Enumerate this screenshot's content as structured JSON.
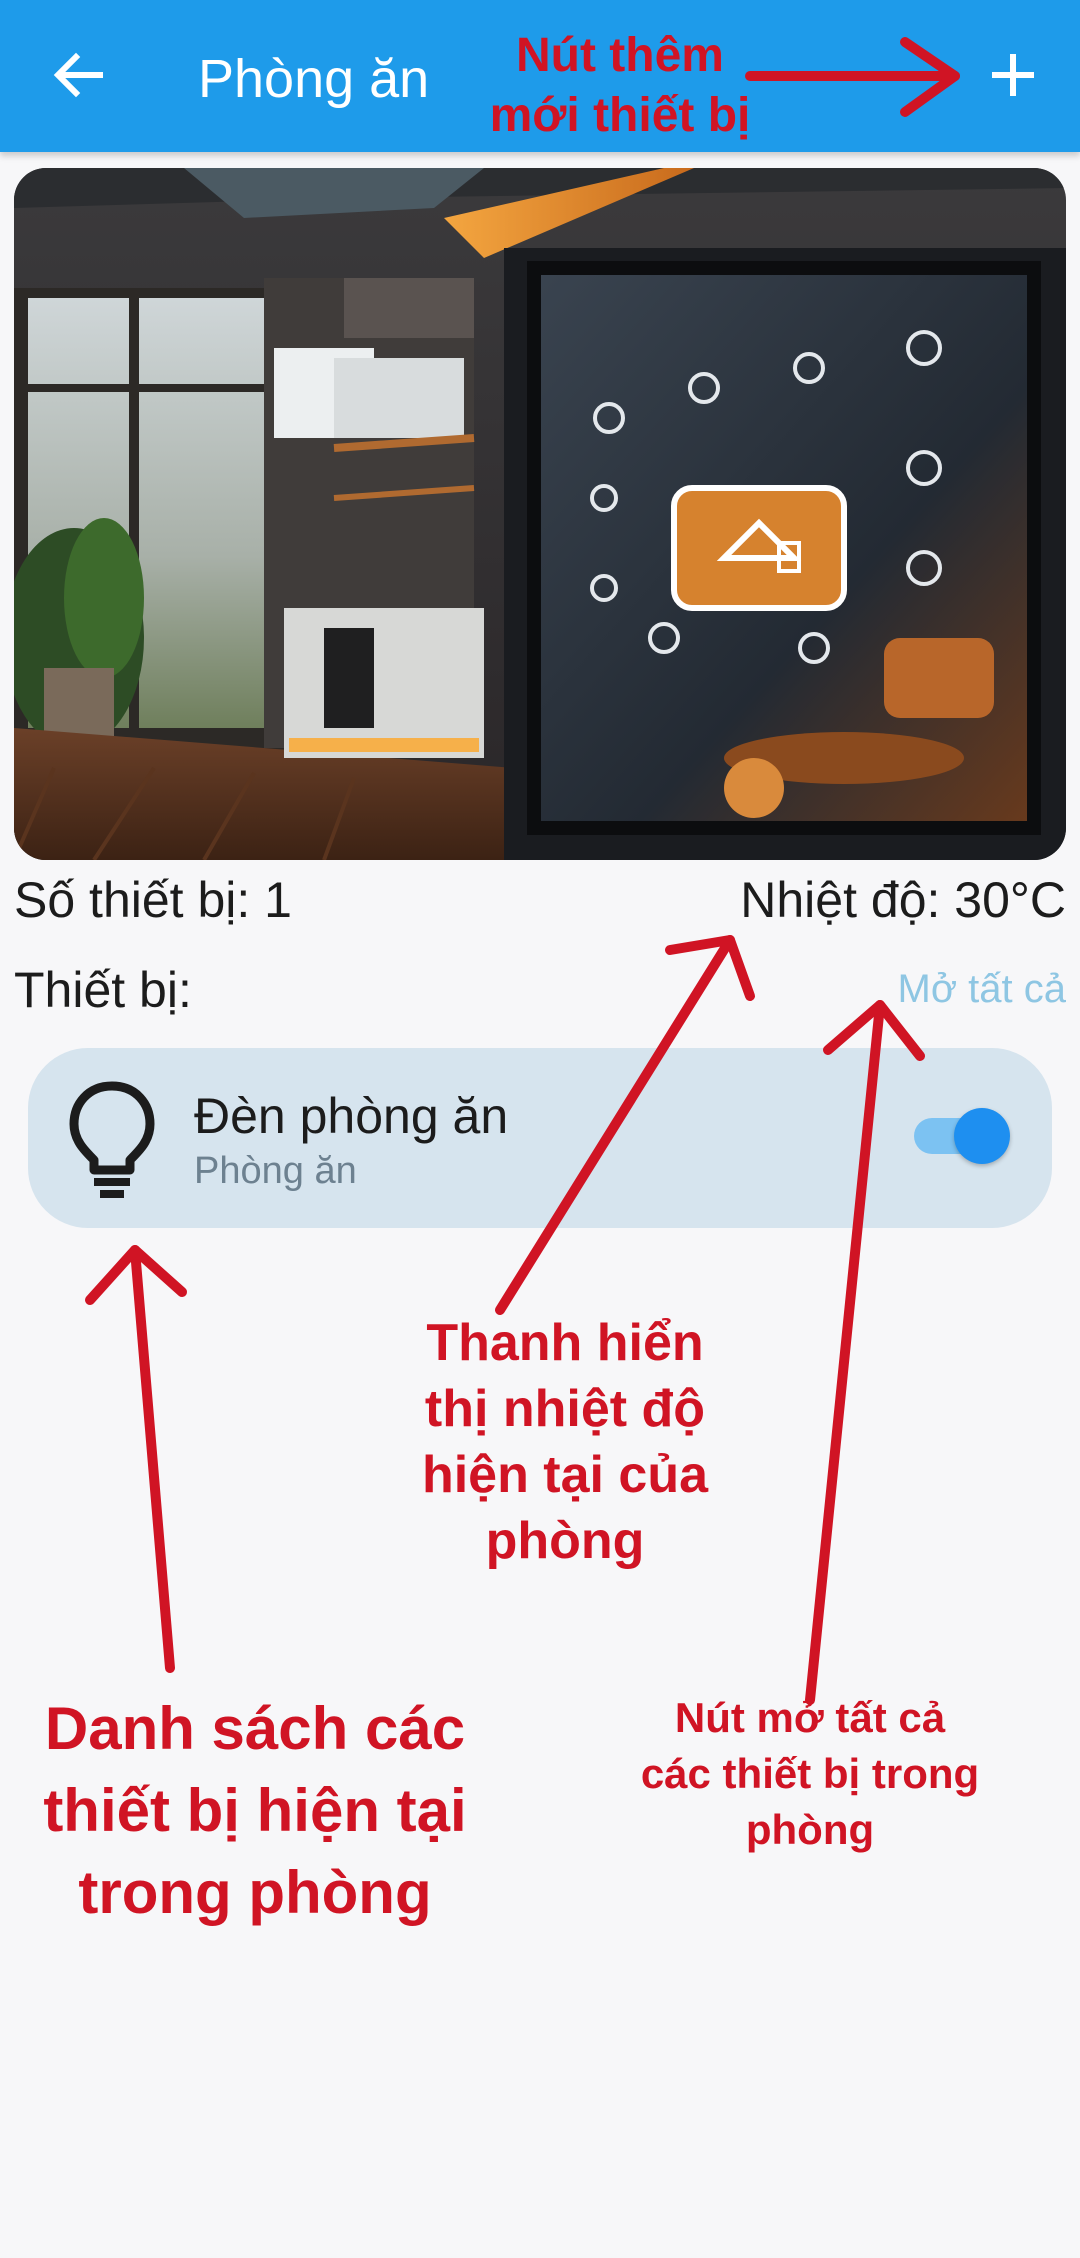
{
  "app_bar": {
    "title": "Phòng ăn",
    "back_icon": "arrow-left-icon",
    "add_icon": "plus-icon",
    "background": "#1e9bea"
  },
  "hero_image": {
    "description_icon": "smart-kitchen-image"
  },
  "stats": {
    "device_count": "Số thiết bị: 1",
    "temperature": "Nhiệt độ: 30°C"
  },
  "devices_section": {
    "label": "Thiết bị:",
    "open_all": "Mở tất cả",
    "items": [
      {
        "name": "Đèn phòng ăn",
        "room": "Phòng ăn",
        "icon": "lightbulb-icon",
        "on": true
      }
    ]
  },
  "annotations": {
    "add_button": "Nút thêm mới thiết bị",
    "temperature_bar": "Thanh hiển thị nhiệt độ hiện tại của phòng",
    "device_list": "Danh sách các thiết bị hiện tại trong phòng",
    "open_all_button": "Nút mở tất cả các thiết bị trong phòng",
    "color": "#d01424"
  }
}
